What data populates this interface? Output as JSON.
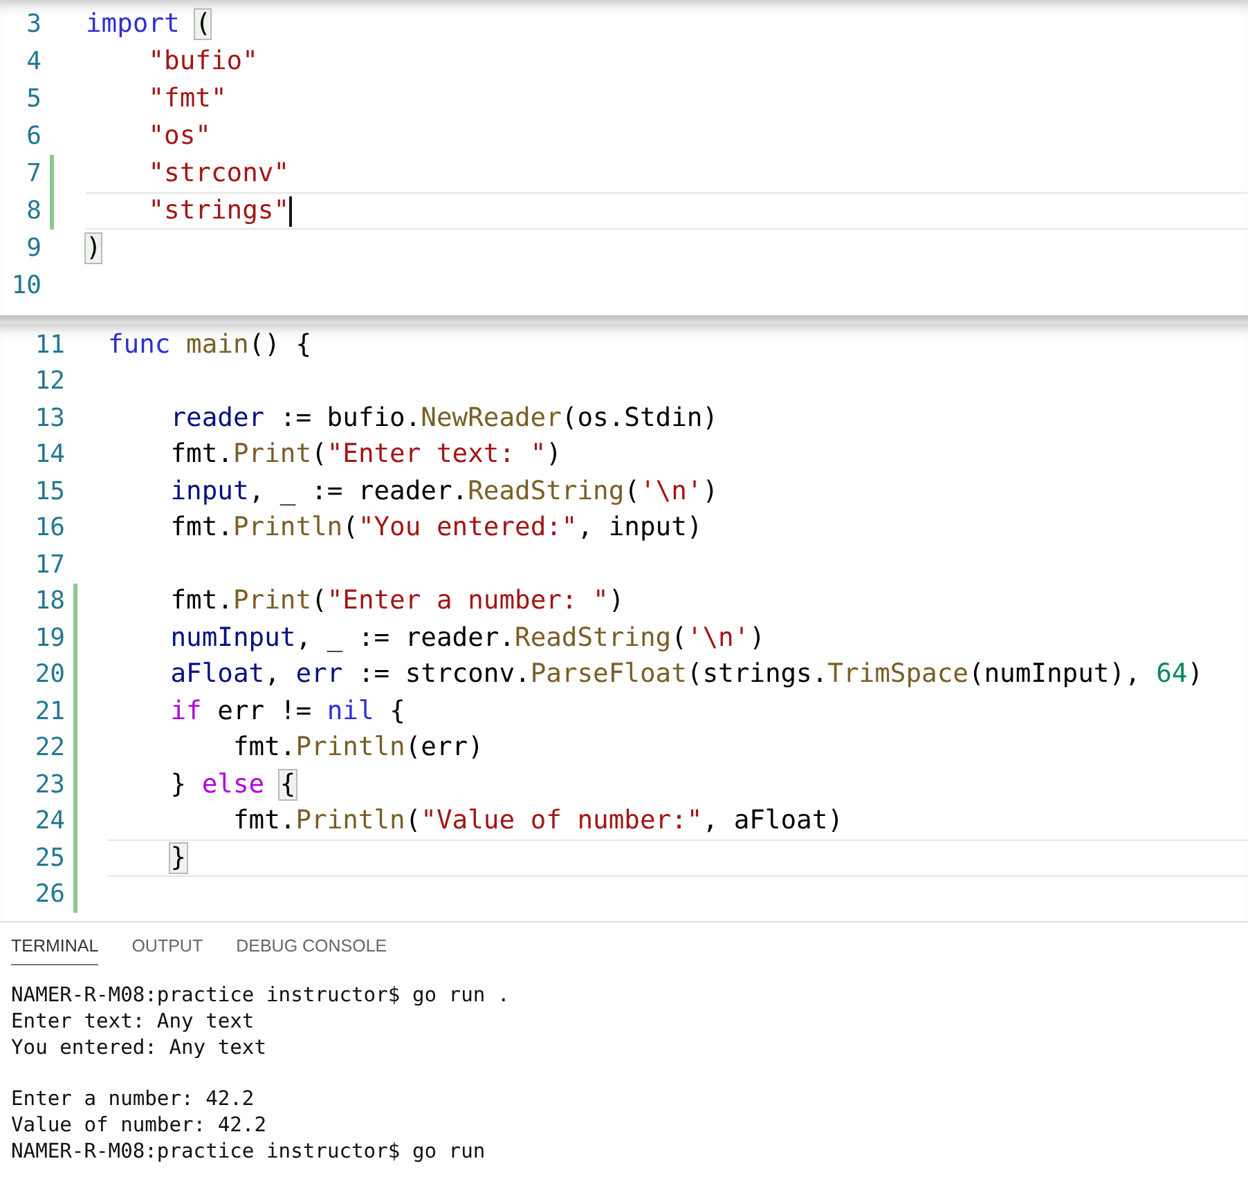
{
  "editor_top": {
    "lines": [
      {
        "number": "3",
        "modified": false,
        "current": false,
        "tokens": [
          {
            "kind": "keyword",
            "text": "import "
          },
          {
            "kind": "match",
            "text": "("
          }
        ]
      },
      {
        "number": "4",
        "modified": false,
        "current": false,
        "tokens": [
          {
            "kind": "string",
            "text": "    \"bufio\""
          }
        ]
      },
      {
        "number": "5",
        "modified": false,
        "current": false,
        "tokens": [
          {
            "kind": "string",
            "text": "    \"fmt\""
          }
        ]
      },
      {
        "number": "6",
        "modified": false,
        "current": false,
        "tokens": [
          {
            "kind": "string",
            "text": "    \"os\""
          }
        ]
      },
      {
        "number": "7",
        "modified": true,
        "current": false,
        "tokens": [
          {
            "kind": "string",
            "text": "    \"strconv\""
          }
        ]
      },
      {
        "number": "8",
        "modified": true,
        "current": true,
        "cursor": true,
        "tokens": [
          {
            "kind": "string",
            "text": "    \"strings\""
          }
        ]
      },
      {
        "number": "9",
        "modified": false,
        "current": false,
        "tokens": [
          {
            "kind": "match",
            "text": ")"
          }
        ]
      },
      {
        "number": "10",
        "modified": false,
        "current": false
      }
    ]
  },
  "editor_bottom": {
    "lines": [
      {
        "number": "11",
        "modified": false,
        "current": false,
        "tokens": [
          {
            "kind": "keyword",
            "text": "func "
          },
          {
            "kind": "function",
            "text": "main"
          },
          {
            "kind": "plain",
            "text": "() {"
          }
        ]
      },
      {
        "number": "12",
        "modified": false,
        "current": false
      },
      {
        "number": "13",
        "modified": false,
        "current": false,
        "tokens": [
          {
            "kind": "variable",
            "text": "    reader"
          },
          {
            "kind": "plain",
            "text": " := bufio."
          },
          {
            "kind": "function",
            "text": "NewReader"
          },
          {
            "kind": "plain",
            "text": "(os.Stdin)"
          }
        ]
      },
      {
        "number": "14",
        "modified": false,
        "current": false,
        "tokens": [
          {
            "kind": "plain",
            "text": "    fmt."
          },
          {
            "kind": "function",
            "text": "Print"
          },
          {
            "kind": "plain",
            "text": "("
          },
          {
            "kind": "string",
            "text": "\"Enter text: \""
          },
          {
            "kind": "plain",
            "text": ")"
          }
        ]
      },
      {
        "number": "15",
        "modified": false,
        "current": false,
        "tokens": [
          {
            "kind": "variable",
            "text": "    input"
          },
          {
            "kind": "plain",
            "text": ", _ := reader."
          },
          {
            "kind": "function",
            "text": "ReadString"
          },
          {
            "kind": "plain",
            "text": "("
          },
          {
            "kind": "string",
            "text": "'\\n'"
          },
          {
            "kind": "plain",
            "text": ")"
          }
        ]
      },
      {
        "number": "16",
        "modified": false,
        "current": false,
        "tokens": [
          {
            "kind": "plain",
            "text": "    fmt."
          },
          {
            "kind": "function",
            "text": "Println"
          },
          {
            "kind": "plain",
            "text": "("
          },
          {
            "kind": "string",
            "text": "\"You entered:\""
          },
          {
            "kind": "plain",
            "text": ", input)"
          }
        ]
      },
      {
        "number": "17",
        "modified": false,
        "current": false
      },
      {
        "number": "18",
        "modified": true,
        "current": false,
        "tokens": [
          {
            "kind": "plain",
            "text": "    fmt."
          },
          {
            "kind": "function",
            "text": "Print"
          },
          {
            "kind": "plain",
            "text": "("
          },
          {
            "kind": "string",
            "text": "\"Enter a number: \""
          },
          {
            "kind": "plain",
            "text": ")"
          }
        ]
      },
      {
        "number": "19",
        "modified": true,
        "current": false,
        "tokens": [
          {
            "kind": "variable",
            "text": "    numInput"
          },
          {
            "kind": "plain",
            "text": ", _ := reader."
          },
          {
            "kind": "function",
            "text": "ReadString"
          },
          {
            "kind": "plain",
            "text": "("
          },
          {
            "kind": "string",
            "text": "'\\n'"
          },
          {
            "kind": "plain",
            "text": ")"
          }
        ]
      },
      {
        "number": "20",
        "modified": true,
        "current": false,
        "tokens": [
          {
            "kind": "variable",
            "text": "    aFloat"
          },
          {
            "kind": "plain",
            "text": ", "
          },
          {
            "kind": "variable",
            "text": "err"
          },
          {
            "kind": "plain",
            "text": " := strconv."
          },
          {
            "kind": "function",
            "text": "ParseFloat"
          },
          {
            "kind": "plain",
            "text": "(strings."
          },
          {
            "kind": "function",
            "text": "TrimSpace"
          },
          {
            "kind": "plain",
            "text": "(numInput), "
          },
          {
            "kind": "number",
            "text": "64"
          },
          {
            "kind": "plain",
            "text": ")"
          }
        ]
      },
      {
        "number": "21",
        "modified": true,
        "current": false,
        "tokens": [
          {
            "kind": "control",
            "text": "    if"
          },
          {
            "kind": "plain",
            "text": " err != "
          },
          {
            "kind": "keyword",
            "text": "nil"
          },
          {
            "kind": "plain",
            "text": " {"
          }
        ]
      },
      {
        "number": "22",
        "modified": true,
        "current": false,
        "tokens": [
          {
            "kind": "plain",
            "text": "        fmt."
          },
          {
            "kind": "function",
            "text": "Println"
          },
          {
            "kind": "plain",
            "text": "(err)"
          }
        ]
      },
      {
        "number": "23",
        "modified": true,
        "current": false,
        "tokens": [
          {
            "kind": "plain",
            "text": "    } "
          },
          {
            "kind": "control",
            "text": "else "
          },
          {
            "kind": "match",
            "text": "{"
          }
        ]
      },
      {
        "number": "24",
        "modified": true,
        "current": false,
        "tokens": [
          {
            "kind": "plain",
            "text": "        fmt."
          },
          {
            "kind": "function",
            "text": "Println"
          },
          {
            "kind": "plain",
            "text": "("
          },
          {
            "kind": "string",
            "text": "\"Value of number:\""
          },
          {
            "kind": "plain",
            "text": ", aFloat)"
          }
        ]
      },
      {
        "number": "25",
        "modified": true,
        "current": true,
        "tokens": [
          {
            "kind": "match",
            "text": "    }"
          }
        ]
      },
      {
        "number": "26",
        "modified": true,
        "current": false
      }
    ]
  },
  "panel": {
    "tabs": [
      {
        "label": "TERMINAL",
        "selected": true
      },
      {
        "label": "OUTPUT",
        "selected": false
      },
      {
        "label": "DEBUG CONSOLE",
        "selected": false
      }
    ],
    "terminal_blocks": [
      [
        "NAMER-R-M08:practice instructor$ go run .",
        "Enter text: Any text",
        "You entered: Any text"
      ],
      [
        "Enter a number: 42.2",
        "Value of number: 42.2",
        "NAMER-R-M08:practice instructor$ go run"
      ]
    ]
  }
}
